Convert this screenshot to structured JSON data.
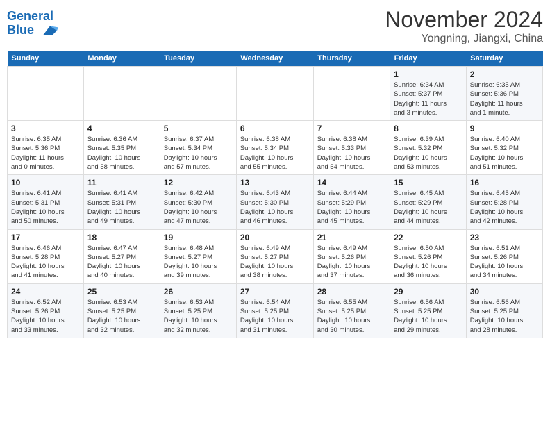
{
  "header": {
    "logo_line1": "General",
    "logo_line2": "Blue",
    "month_year": "November 2024",
    "location": "Yongning, Jiangxi, China"
  },
  "weekdays": [
    "Sunday",
    "Monday",
    "Tuesday",
    "Wednesday",
    "Thursday",
    "Friday",
    "Saturday"
  ],
  "weeks": [
    [
      {
        "day": "",
        "info": ""
      },
      {
        "day": "",
        "info": ""
      },
      {
        "day": "",
        "info": ""
      },
      {
        "day": "",
        "info": ""
      },
      {
        "day": "",
        "info": ""
      },
      {
        "day": "1",
        "info": "Sunrise: 6:34 AM\nSunset: 5:37 PM\nDaylight: 11 hours\nand 3 minutes."
      },
      {
        "day": "2",
        "info": "Sunrise: 6:35 AM\nSunset: 5:36 PM\nDaylight: 11 hours\nand 1 minute."
      }
    ],
    [
      {
        "day": "3",
        "info": "Sunrise: 6:35 AM\nSunset: 5:36 PM\nDaylight: 11 hours\nand 0 minutes."
      },
      {
        "day": "4",
        "info": "Sunrise: 6:36 AM\nSunset: 5:35 PM\nDaylight: 10 hours\nand 58 minutes."
      },
      {
        "day": "5",
        "info": "Sunrise: 6:37 AM\nSunset: 5:34 PM\nDaylight: 10 hours\nand 57 minutes."
      },
      {
        "day": "6",
        "info": "Sunrise: 6:38 AM\nSunset: 5:34 PM\nDaylight: 10 hours\nand 55 minutes."
      },
      {
        "day": "7",
        "info": "Sunrise: 6:38 AM\nSunset: 5:33 PM\nDaylight: 10 hours\nand 54 minutes."
      },
      {
        "day": "8",
        "info": "Sunrise: 6:39 AM\nSunset: 5:32 PM\nDaylight: 10 hours\nand 53 minutes."
      },
      {
        "day": "9",
        "info": "Sunrise: 6:40 AM\nSunset: 5:32 PM\nDaylight: 10 hours\nand 51 minutes."
      }
    ],
    [
      {
        "day": "10",
        "info": "Sunrise: 6:41 AM\nSunset: 5:31 PM\nDaylight: 10 hours\nand 50 minutes."
      },
      {
        "day": "11",
        "info": "Sunrise: 6:41 AM\nSunset: 5:31 PM\nDaylight: 10 hours\nand 49 minutes."
      },
      {
        "day": "12",
        "info": "Sunrise: 6:42 AM\nSunset: 5:30 PM\nDaylight: 10 hours\nand 47 minutes."
      },
      {
        "day": "13",
        "info": "Sunrise: 6:43 AM\nSunset: 5:30 PM\nDaylight: 10 hours\nand 46 minutes."
      },
      {
        "day": "14",
        "info": "Sunrise: 6:44 AM\nSunset: 5:29 PM\nDaylight: 10 hours\nand 45 minutes."
      },
      {
        "day": "15",
        "info": "Sunrise: 6:45 AM\nSunset: 5:29 PM\nDaylight: 10 hours\nand 44 minutes."
      },
      {
        "day": "16",
        "info": "Sunrise: 6:45 AM\nSunset: 5:28 PM\nDaylight: 10 hours\nand 42 minutes."
      }
    ],
    [
      {
        "day": "17",
        "info": "Sunrise: 6:46 AM\nSunset: 5:28 PM\nDaylight: 10 hours\nand 41 minutes."
      },
      {
        "day": "18",
        "info": "Sunrise: 6:47 AM\nSunset: 5:27 PM\nDaylight: 10 hours\nand 40 minutes."
      },
      {
        "day": "19",
        "info": "Sunrise: 6:48 AM\nSunset: 5:27 PM\nDaylight: 10 hours\nand 39 minutes."
      },
      {
        "day": "20",
        "info": "Sunrise: 6:49 AM\nSunset: 5:27 PM\nDaylight: 10 hours\nand 38 minutes."
      },
      {
        "day": "21",
        "info": "Sunrise: 6:49 AM\nSunset: 5:26 PM\nDaylight: 10 hours\nand 37 minutes."
      },
      {
        "day": "22",
        "info": "Sunrise: 6:50 AM\nSunset: 5:26 PM\nDaylight: 10 hours\nand 36 minutes."
      },
      {
        "day": "23",
        "info": "Sunrise: 6:51 AM\nSunset: 5:26 PM\nDaylight: 10 hours\nand 34 minutes."
      }
    ],
    [
      {
        "day": "24",
        "info": "Sunrise: 6:52 AM\nSunset: 5:26 PM\nDaylight: 10 hours\nand 33 minutes."
      },
      {
        "day": "25",
        "info": "Sunrise: 6:53 AM\nSunset: 5:25 PM\nDaylight: 10 hours\nand 32 minutes."
      },
      {
        "day": "26",
        "info": "Sunrise: 6:53 AM\nSunset: 5:25 PM\nDaylight: 10 hours\nand 32 minutes."
      },
      {
        "day": "27",
        "info": "Sunrise: 6:54 AM\nSunset: 5:25 PM\nDaylight: 10 hours\nand 31 minutes."
      },
      {
        "day": "28",
        "info": "Sunrise: 6:55 AM\nSunset: 5:25 PM\nDaylight: 10 hours\nand 30 minutes."
      },
      {
        "day": "29",
        "info": "Sunrise: 6:56 AM\nSunset: 5:25 PM\nDaylight: 10 hours\nand 29 minutes."
      },
      {
        "day": "30",
        "info": "Sunrise: 6:56 AM\nSunset: 5:25 PM\nDaylight: 10 hours\nand 28 minutes."
      }
    ]
  ]
}
